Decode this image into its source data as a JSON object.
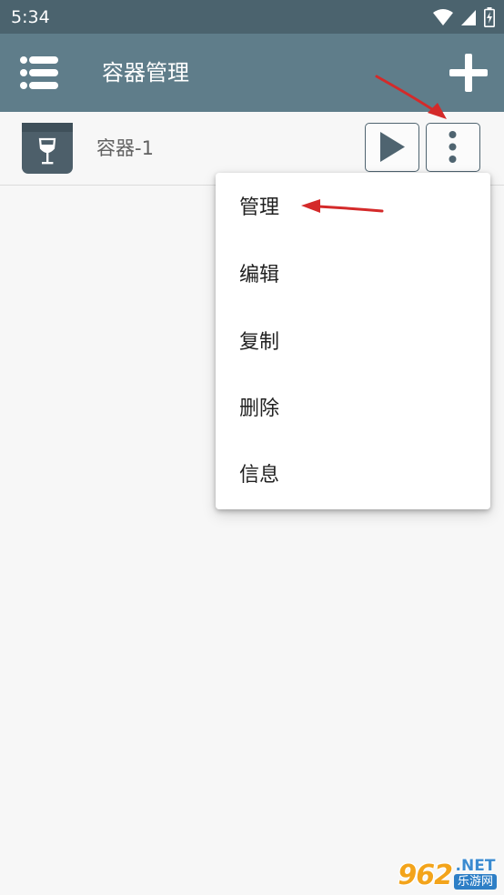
{
  "status_bar": {
    "time": "5:34"
  },
  "app_bar": {
    "title": "容器管理"
  },
  "containers": [
    {
      "name": "容器-1"
    }
  ],
  "popup_menu": {
    "items": [
      "管理",
      "编辑",
      "复制",
      "删除",
      "信息"
    ]
  },
  "watermark": {
    "number": "962",
    "suffix": ".NET",
    "site": "乐游网"
  },
  "colors": {
    "status_bar": "#4b636e",
    "app_bar": "#5f7d8a",
    "icon_bg": "#4d5f6a",
    "annotation_arrow": "#d42a2a"
  }
}
